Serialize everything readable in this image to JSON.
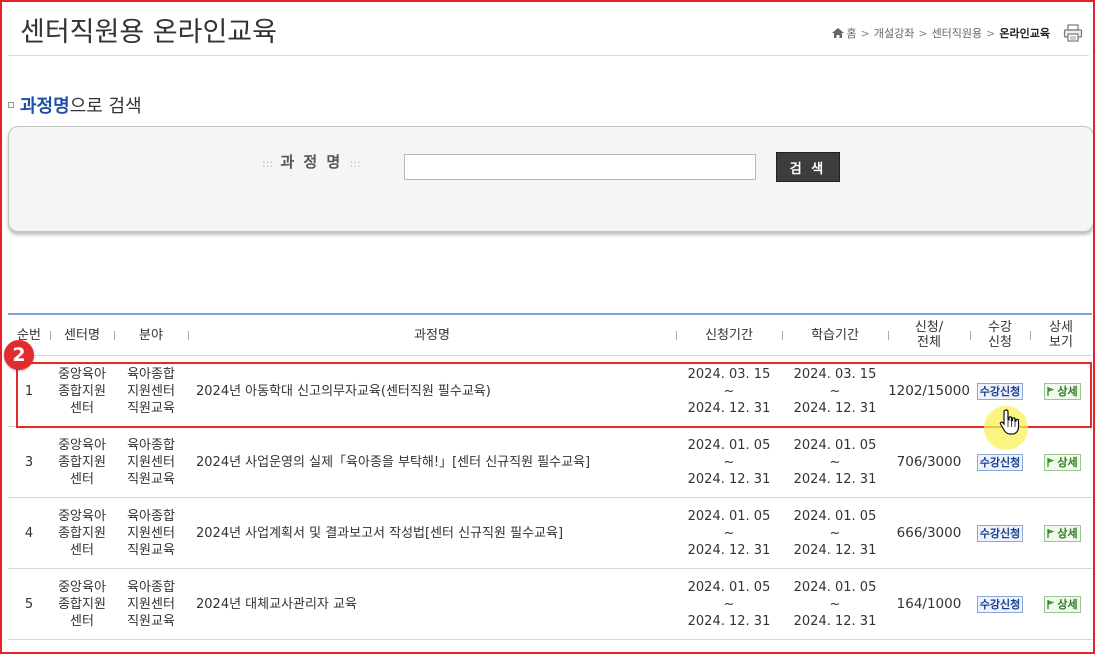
{
  "header": {
    "title": "센터직원용 온라인교육",
    "breadcrumb": [
      "홈",
      "개설강좌",
      "센터직원용",
      "온라인교육"
    ]
  },
  "search_section": {
    "title_highlight": "과정명",
    "title_rest": "으로 검색",
    "field_label": "과 정 명",
    "label_deco": ":::",
    "input_value": "",
    "button_label": "검 색"
  },
  "table": {
    "columns": [
      "순번",
      "센터명",
      "분야",
      "과정명",
      "신청기간",
      "학습기간",
      "신청/\n전체",
      "수강\n신청",
      "상세\n보기"
    ],
    "column_headers": {
      "no": "순번",
      "center": "센터명",
      "field": "분야",
      "course": "과정명",
      "apply_period": "신청기간",
      "study_period": "학습기간",
      "count_a": "신청/",
      "count_b": "전체",
      "enroll_a": "수강",
      "enroll_b": "신청",
      "detail_a": "상세",
      "detail_b": "보기"
    },
    "rows": [
      {
        "no": "1",
        "center": [
          "중앙육아",
          "종합지원",
          "센터"
        ],
        "field": [
          "육아종합",
          "지원센터",
          "직원교육"
        ],
        "course": "2024년 아동학대 신고의무자교육(센터직원 필수교육)",
        "apply_period": [
          "2024. 03. 15",
          "~",
          "2024. 12. 31"
        ],
        "study_period": [
          "2024. 03. 15",
          "~",
          "2024. 12. 31"
        ],
        "count": "1202/15000",
        "enroll_label": "수강신청",
        "detail_label": "상세"
      },
      {
        "no": "3",
        "center": [
          "중앙육아",
          "종합지원",
          "센터"
        ],
        "field": [
          "육아종합",
          "지원센터",
          "직원교육"
        ],
        "course": "2024년 사업운영의 실제「육아종을 부탁해!」[센터 신규직원 필수교육]",
        "apply_period": [
          "2024. 01. 05",
          "~",
          "2024. 12. 31"
        ],
        "study_period": [
          "2024. 01. 05",
          "~",
          "2024. 12. 31"
        ],
        "count": "706/3000",
        "enroll_label": "수강신청",
        "detail_label": "상세"
      },
      {
        "no": "4",
        "center": [
          "중앙육아",
          "종합지원",
          "센터"
        ],
        "field": [
          "육아종합",
          "지원센터",
          "직원교육"
        ],
        "course": "2024년 사업계획서 및 결과보고서 작성법[센터 신규직원 필수교육]",
        "apply_period": [
          "2024. 01. 05",
          "~",
          "2024. 12. 31"
        ],
        "study_period": [
          "2024. 01. 05",
          "~",
          "2024. 12. 31"
        ],
        "count": "666/3000",
        "enroll_label": "수강신청",
        "detail_label": "상세"
      },
      {
        "no": "5",
        "center": [
          "중앙육아",
          "종합지원",
          "센터"
        ],
        "field": [
          "육아종합",
          "지원센터",
          "직원교육"
        ],
        "course": "2024년 대체교사관리자 교육",
        "apply_period": [
          "2024. 01. 05",
          "~",
          "2024. 12. 31"
        ],
        "study_period": [
          "2024. 01. 05",
          "~",
          "2024. 12. 31"
        ],
        "count": "164/1000",
        "enroll_label": "수강신청",
        "detail_label": "상세"
      }
    ]
  },
  "annotation": {
    "step_number": "2"
  },
  "icons": {
    "home": "home-icon",
    "print": "print-icon",
    "bullet": "bullet-icon",
    "flag": "flag-icon",
    "cursor": "hand-cursor-icon"
  },
  "colors": {
    "frame_border": "#e8202a",
    "highlight": "#e32b2b",
    "link_blue": "#1f4fa7",
    "header_rule": "#76a3d8",
    "search_button": "#3d3d3d"
  }
}
